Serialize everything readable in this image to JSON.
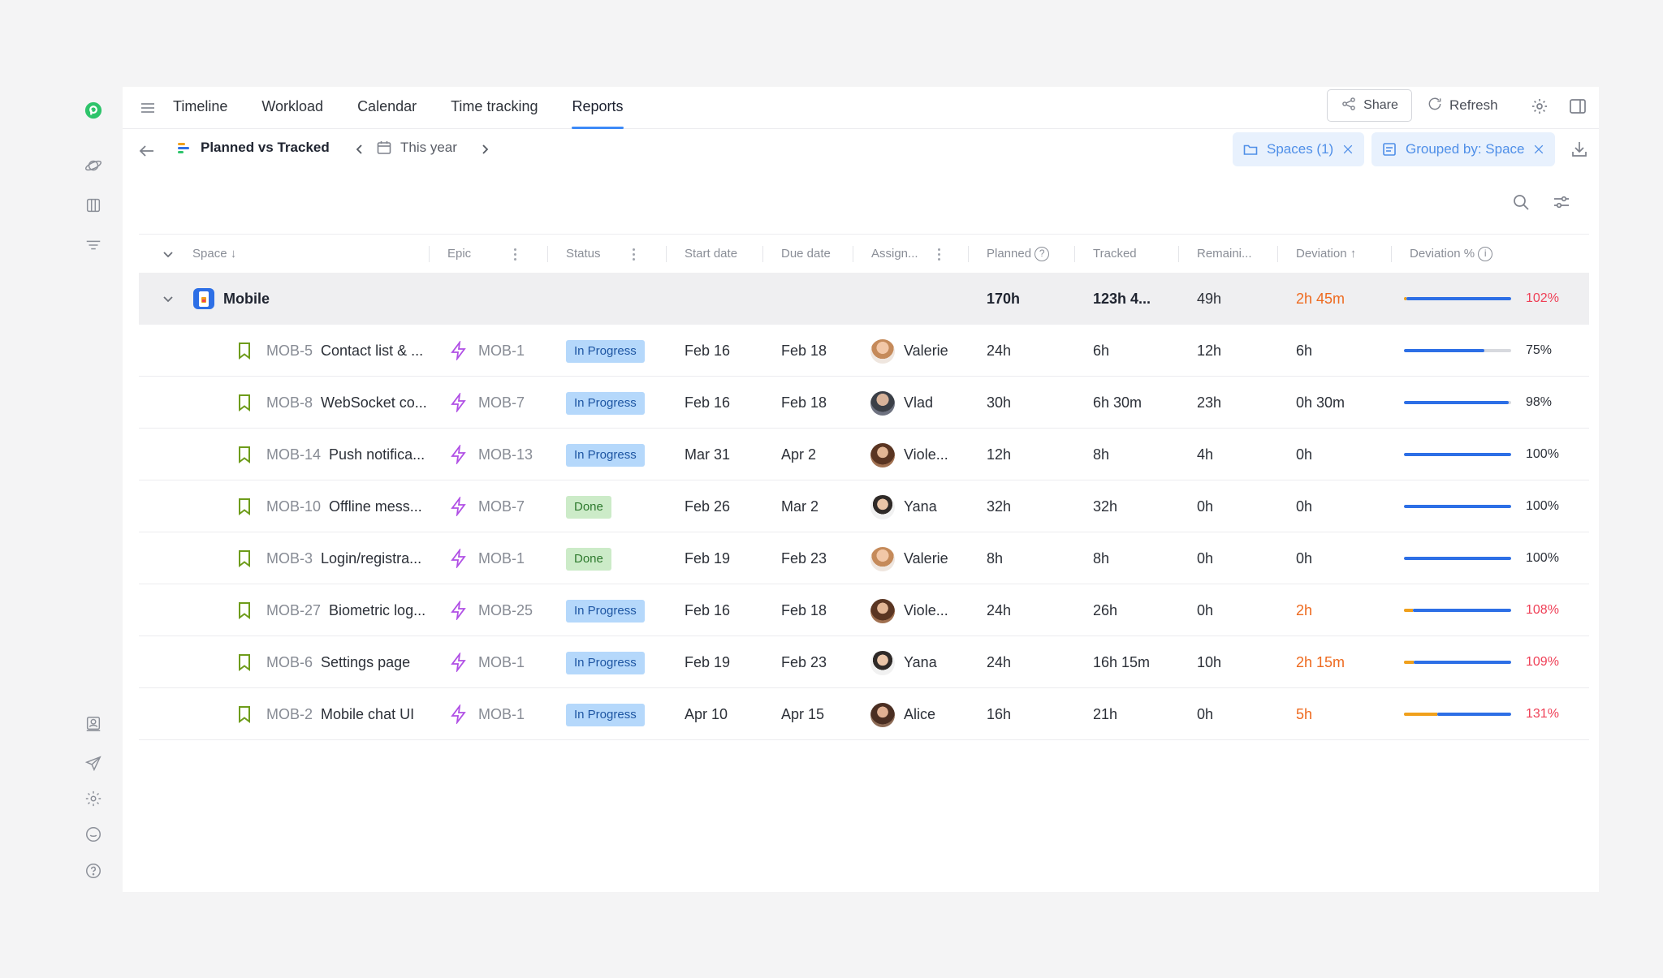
{
  "nav": {
    "tabs": [
      {
        "label": "Timeline",
        "active": false
      },
      {
        "label": "Workload",
        "active": false
      },
      {
        "label": "Calendar",
        "active": false
      },
      {
        "label": "Time tracking",
        "active": false
      },
      {
        "label": "Reports",
        "active": true
      }
    ],
    "share_label": "Share",
    "refresh_label": "Refresh"
  },
  "report": {
    "title": "Planned vs Tracked",
    "period": "This year",
    "filters": [
      {
        "label": "Spaces (1)"
      },
      {
        "label": "Grouped by: Space"
      }
    ]
  },
  "table": {
    "columns": {
      "space": "Space",
      "epic": "Epic",
      "status": "Status",
      "start": "Start date",
      "due": "Due date",
      "assignee": "Assign...",
      "planned": "Planned",
      "tracked": "Tracked",
      "remaining": "Remaini...",
      "deviation": "Deviation",
      "deviation_pct": "Deviation %"
    },
    "group": {
      "name": "Mobile",
      "planned": "170h",
      "tracked": "123h 4...",
      "remaining": "49h",
      "deviation": "2h 45m",
      "deviation_pct": "102%",
      "progress": 1.02
    },
    "rows": [
      {
        "key": "MOB-5",
        "title": "Contact list & ...",
        "epic": "MOB-1",
        "status": "In Progress",
        "start": "Feb 16",
        "due": "Feb 18",
        "assignee": "Valerie",
        "planned": "24h",
        "tracked": "6h",
        "remaining": "12h",
        "deviation": "6h",
        "deviation_pct": "75%",
        "progress": 0.75
      },
      {
        "key": "MOB-8",
        "title": "WebSocket co...",
        "epic": "MOB-7",
        "status": "In Progress",
        "start": "Feb 16",
        "due": "Feb 18",
        "assignee": "Vlad",
        "planned": "30h",
        "tracked": "6h 30m",
        "remaining": "23h",
        "deviation": "0h 30m",
        "deviation_pct": "98%",
        "progress": 0.98
      },
      {
        "key": "MOB-14",
        "title": "Push notifica...",
        "epic": "MOB-13",
        "status": "In Progress",
        "start": "Mar 31",
        "due": "Apr 2",
        "assignee": "Viole...",
        "planned": "12h",
        "tracked": "8h",
        "remaining": "4h",
        "deviation": "0h",
        "deviation_pct": "100%",
        "progress": 1.0
      },
      {
        "key": "MOB-10",
        "title": "Offline mess...",
        "epic": "MOB-7",
        "status": "Done",
        "start": "Feb 26",
        "due": "Mar 2",
        "assignee": "Yana",
        "planned": "32h",
        "tracked": "32h",
        "remaining": "0h",
        "deviation": "0h",
        "deviation_pct": "100%",
        "progress": 1.0
      },
      {
        "key": "MOB-3",
        "title": "Login/registra...",
        "epic": "MOB-1",
        "status": "Done",
        "start": "Feb 19",
        "due": "Feb 23",
        "assignee": "Valerie",
        "planned": "8h",
        "tracked": "8h",
        "remaining": "0h",
        "deviation": "0h",
        "deviation_pct": "100%",
        "progress": 1.0
      },
      {
        "key": "MOB-27",
        "title": "Biometric log...",
        "epic": "MOB-25",
        "status": "In Progress",
        "start": "Feb 16",
        "due": "Feb 18",
        "assignee": "Viole...",
        "planned": "24h",
        "tracked": "26h",
        "remaining": "0h",
        "deviation": "2h",
        "deviation_pct": "108%",
        "progress": 1.08
      },
      {
        "key": "MOB-6",
        "title": "Settings page",
        "epic": "MOB-1",
        "status": "In Progress",
        "start": "Feb 19",
        "due": "Feb 23",
        "assignee": "Yana",
        "planned": "24h",
        "tracked": "16h 15m",
        "remaining": "10h",
        "deviation": "2h 15m",
        "deviation_pct": "109%",
        "progress": 1.09
      },
      {
        "key": "MOB-2",
        "title": "Mobile chat UI",
        "epic": "MOB-1",
        "status": "In Progress",
        "start": "Apr 10",
        "due": "Apr 15",
        "assignee": "Alice",
        "planned": "16h",
        "tracked": "21h",
        "remaining": "0h",
        "deviation": "5h",
        "deviation_pct": "131%",
        "progress": 1.31
      }
    ]
  },
  "colors": {
    "accent": "#3d8af7",
    "progress_blue": "#2d6fe6",
    "over_orange": "#f0a01c",
    "deviation_orange": "#ee6a1f",
    "deviation_red": "#ef3f56",
    "status_in_progress": "#b5d8fb",
    "status_done": "#ccebc8",
    "logo_green": "#2ec46b"
  },
  "icons": [
    "logo-icon",
    "planet-icon",
    "board-icon",
    "filter-lines-icon",
    "contacts-icon",
    "send-icon",
    "gear-icon",
    "chat-icon",
    "help-icon",
    "menu-icon",
    "share-icon",
    "refresh-icon",
    "sidebar-toggle-icon",
    "back-arrow-icon",
    "calendar-icon",
    "folder-icon",
    "grouping-icon",
    "close-icon",
    "download-icon",
    "search-icon",
    "sliders-icon",
    "bookmark-icon",
    "bolt-icon",
    "chevron-down-icon",
    "info-icon"
  ]
}
